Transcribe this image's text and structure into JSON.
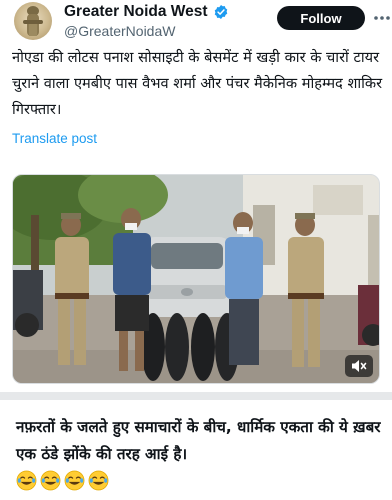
{
  "header": {
    "display_name": "Greater Noida West",
    "handle": "@GreaterNoidaW",
    "follow_label": "Follow",
    "avatar_icon": "deity-statue-avatar",
    "verified_icon": "verified-badge-icon"
  },
  "post": {
    "text": "नोएडा की लोटस पनाश सोसाइटी के बेसमेंट में खड़ी कार के चारों टायर चुराने वाला एमबीए पास वैभव शर्मा और पंचर मैकेनिक मोहम्मद शाकिर गिरफ्तार।",
    "translate_label": "Translate post"
  },
  "media": {
    "description_icon": "photo-police-with-arrested-men-and-tyres",
    "mute_icon": "speaker-muted-icon"
  },
  "comment": {
    "text": "नफ़रतों के जलते हुए समाचारों के बीच, धार्मिक एकता की ये ख़बर एक ठंडे झोंके की तरह आई है।",
    "emojis": [
      "😂",
      "😂",
      "😂",
      "😂"
    ]
  },
  "colors": {
    "link": "#1d9bf0",
    "follow_bg": "#0f1419",
    "muted_text": "#536471"
  }
}
